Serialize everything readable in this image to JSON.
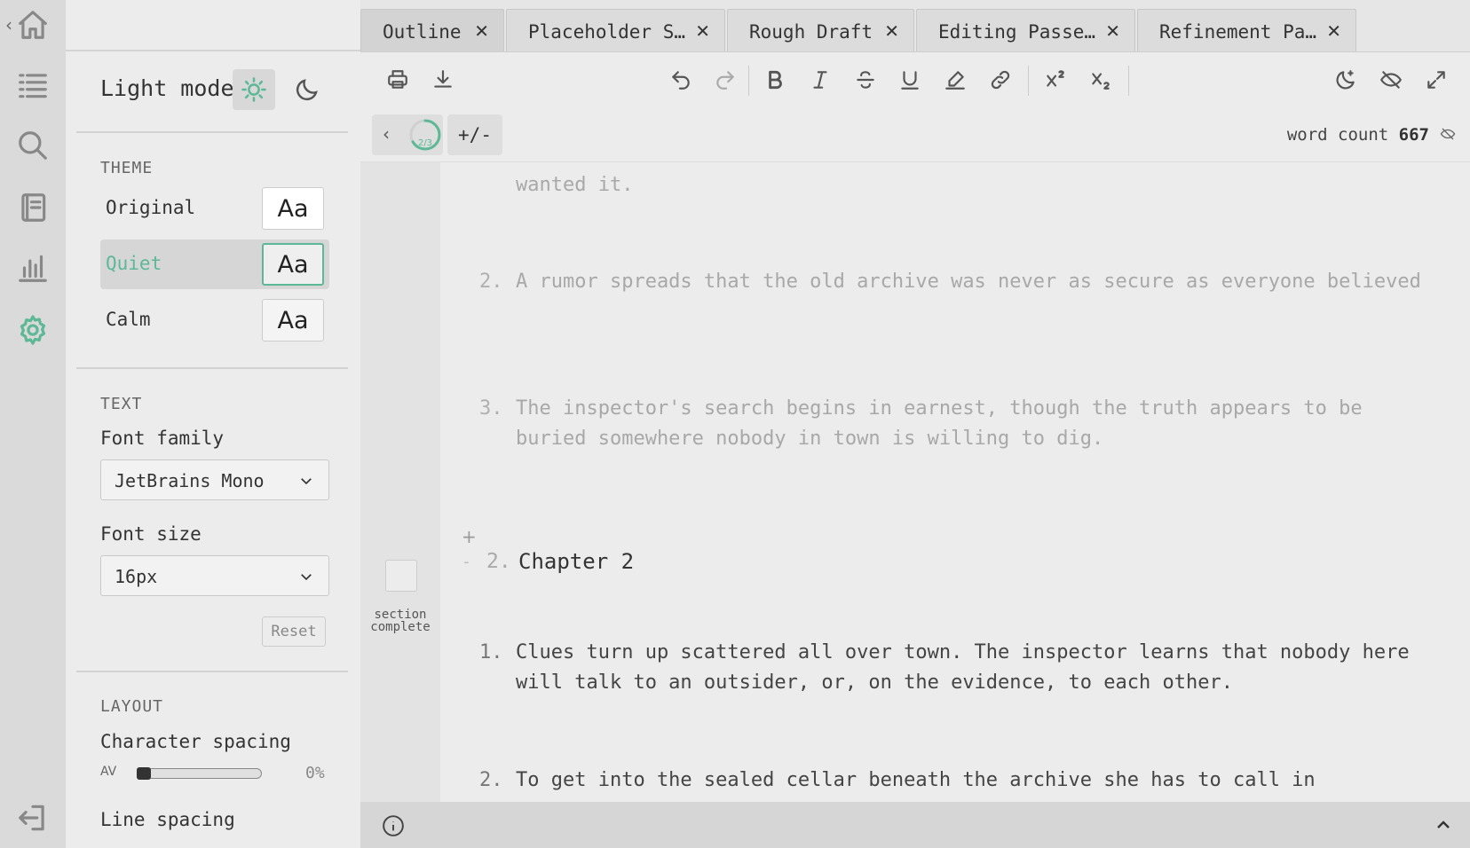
{
  "sidebar": {
    "icons": [
      "home-icon",
      "outline-list-icon",
      "search-icon",
      "notebook-icon",
      "stats-chart-icon",
      "gear-icon",
      "exit-icon"
    ],
    "active": "gear-icon"
  },
  "settings": {
    "mode_label": "Light mode",
    "theme_title": "THEME",
    "themes": [
      {
        "name": "Original",
        "sample": "Aa"
      },
      {
        "name": "Quiet",
        "sample": "Aa"
      },
      {
        "name": "Calm",
        "sample": "Aa"
      }
    ],
    "selected_theme": "Quiet",
    "text_title": "TEXT",
    "font_family_label": "Font family",
    "font_family_value": "JetBrains Mono",
    "font_size_label": "Font size",
    "font_size_value": "16px",
    "reset_label": "Reset",
    "layout_title": "LAYOUT",
    "char_spacing_label": "Character spacing",
    "char_spacing_icon": "AV",
    "char_spacing_value": "0%",
    "line_spacing_label": "Line spacing"
  },
  "tabs": [
    {
      "label": "Outline"
    },
    {
      "label": "Placeholder S…"
    },
    {
      "label": "Rough Draft"
    },
    {
      "label": "Editing Passe…"
    },
    {
      "label": "Refinement Pa…"
    }
  ],
  "toolbar": {
    "icons": [
      "print-icon",
      "download-icon",
      "undo-icon",
      "redo-icon",
      "bold-icon",
      "italic-icon",
      "strikethrough-icon",
      "underline-icon",
      "highlighter-icon",
      "link-icon",
      "superscript-icon",
      "subscript-icon",
      "night-mode-icon",
      "hide-icon",
      "fullscreen-icon"
    ]
  },
  "subbar": {
    "progress_text": "2/3",
    "progress_fraction": 0.667,
    "plus_minus_label": "+/-",
    "word_count_label": "word count",
    "word_count_value": "667"
  },
  "document": {
    "top_fragment": "wanted it.",
    "chapter1_items": [
      {
        "num": "2.",
        "text": "A rumor spreads that the old archive was never as secure as everyone believed"
      },
      {
        "num": "3.",
        "text": "The inspector's search begins in earnest, though the truth appears to be buried somewhere nobody in town is willing to dig."
      }
    ],
    "chapter2": {
      "plus": "+",
      "minus": "-",
      "num": "2.",
      "title": "Chapter 2",
      "section_label": "section complete",
      "items": [
        {
          "num": "1.",
          "text": "Clues turn up scattered all over town. The inspector learns that nobody here will talk to an outsider, or, on the evidence, to each other."
        },
        {
          "num": "2.",
          "text": "To get into the sealed cellar beneath the archive she has to call in"
        }
      ]
    }
  }
}
